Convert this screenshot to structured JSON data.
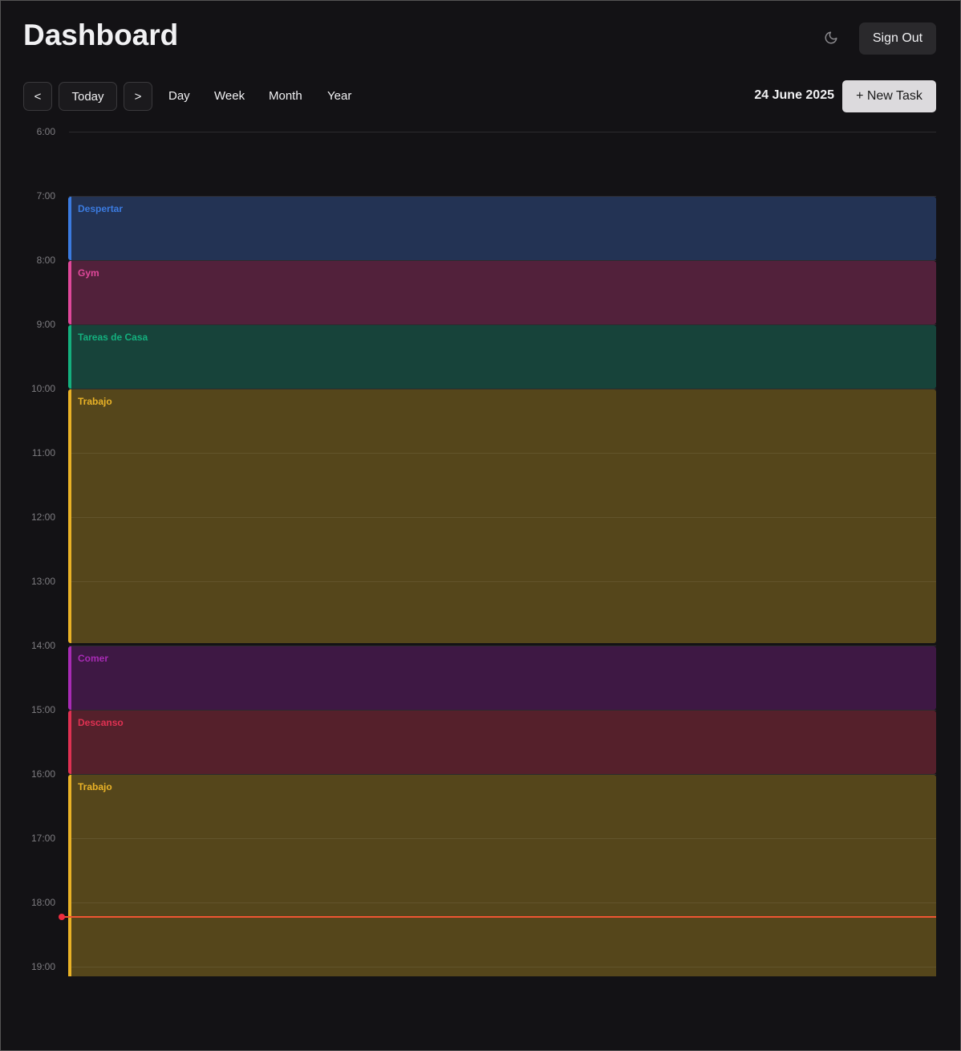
{
  "header": {
    "title": "Dashboard",
    "theme_icon": "moon-icon",
    "sign_out": "Sign Out"
  },
  "toolbar": {
    "prev": "<",
    "today": "Today",
    "next": ">",
    "views": [
      "Day",
      "Week",
      "Month",
      "Year"
    ],
    "date": "24 June 2025",
    "new_task": "+ New Task"
  },
  "calendar": {
    "hours": [
      "6:00",
      "7:00",
      "8:00",
      "9:00",
      "10:00",
      "11:00",
      "12:00",
      "13:00",
      "14:00",
      "15:00",
      "16:00",
      "17:00",
      "18:00",
      "19:00"
    ],
    "first_hour": 6,
    "now_hour": 18.23,
    "events": [
      {
        "title": "Despertar",
        "start": 7,
        "end": 8,
        "color": "#3b7be0",
        "bg": "#233354"
      },
      {
        "title": "Gym",
        "start": 8,
        "end": 9,
        "color": "#e0489a",
        "bg": "#52213b"
      },
      {
        "title": "Tareas de Casa",
        "start": 9,
        "end": 10,
        "color": "#14b07e",
        "bg": "#17433a"
      },
      {
        "title": "Trabajo",
        "start": 10,
        "end": 14,
        "color": "#e9b227",
        "bg": "#55461b"
      },
      {
        "title": "Comer",
        "start": 14,
        "end": 15,
        "color": "#a82bb5",
        "bg": "#3e1844"
      },
      {
        "title": "Descanso",
        "start": 15,
        "end": 16,
        "color": "#e03152",
        "bg": "#55202b"
      },
      {
        "title": "Trabajo",
        "start": 16,
        "end": 20,
        "color": "#e9b227",
        "bg": "#55461b"
      }
    ]
  }
}
